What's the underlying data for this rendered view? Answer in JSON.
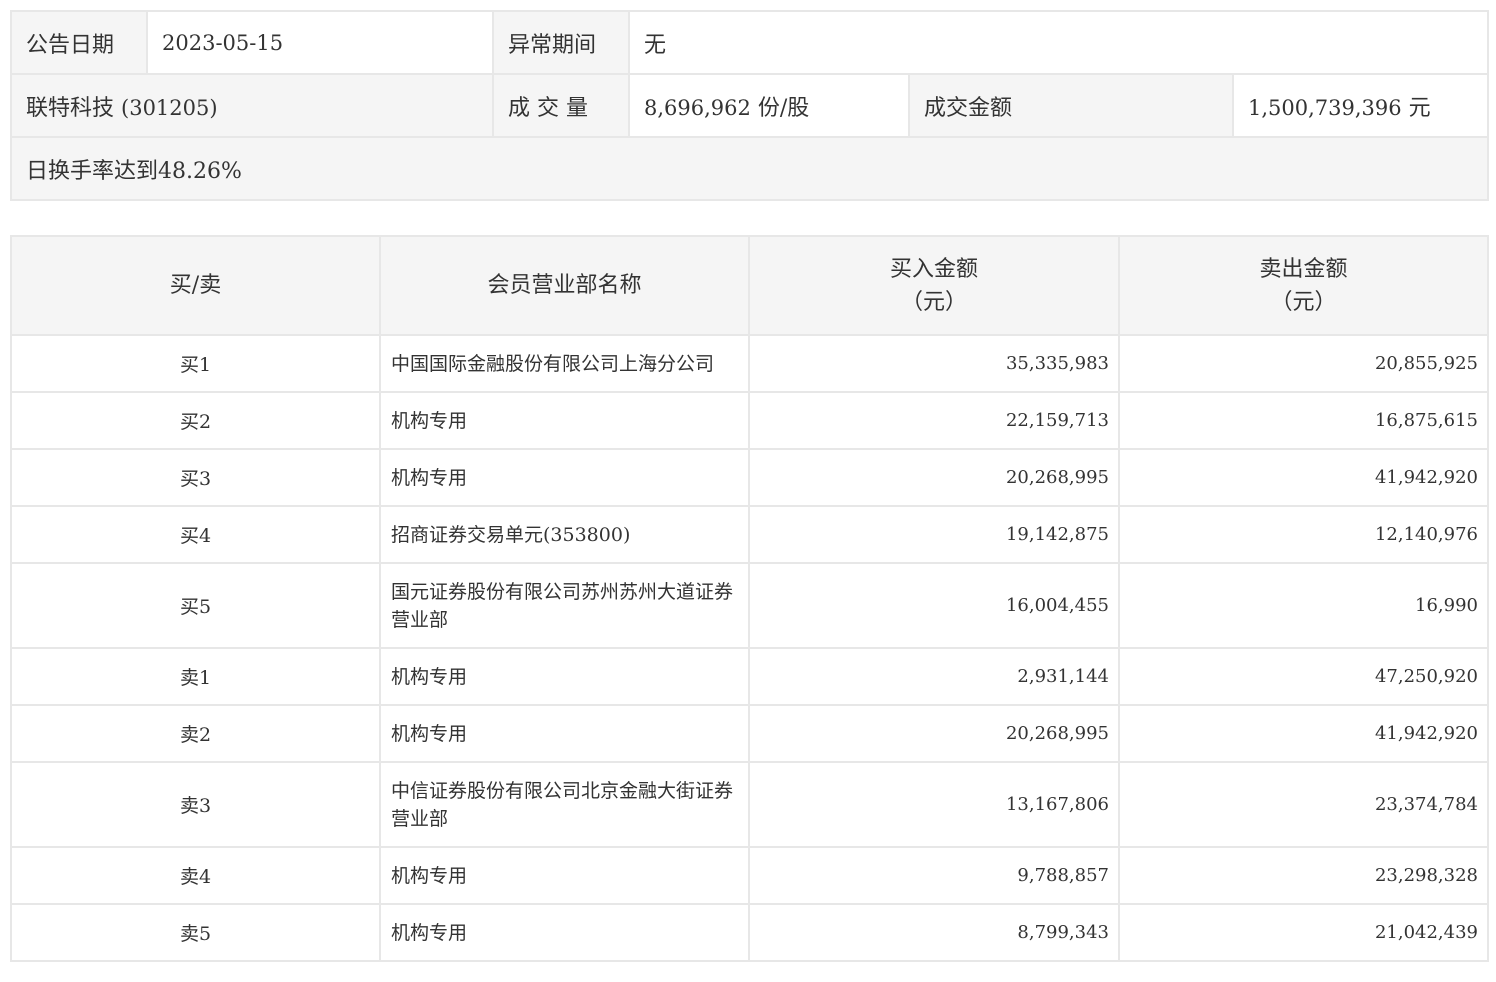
{
  "info": {
    "date_label": "公告日期",
    "date_value": "2023-05-15",
    "period_label": "异常期间",
    "period_value": "无",
    "stock_name": "联特科技",
    "stock_code": "(301205)",
    "volume_label": "成 交 量",
    "volume_value": "8,696,962",
    "volume_unit": " 份/股",
    "turnover_label": "成交金额",
    "turnover_value": "1,500,739,396",
    "turnover_unit": " 元",
    "reason": "日换手率达到48.26%"
  },
  "trade_table": {
    "headers": {
      "side": "买/卖",
      "dept": "会员营业部名称",
      "buy": "买入金额",
      "buy_unit": "（元）",
      "sell": "卖出金额",
      "sell_unit": "（元）"
    },
    "rows": [
      {
        "side": "买1",
        "dept": "中国国际金融股份有限公司上海分公司",
        "buy": "35,335,983",
        "sell": "20,855,925"
      },
      {
        "side": "买2",
        "dept": "机构专用",
        "buy": "22,159,713",
        "sell": "16,875,615"
      },
      {
        "side": "买3",
        "dept": "机构专用",
        "buy": "20,268,995",
        "sell": "41,942,920"
      },
      {
        "side": "买4",
        "dept": "招商证券交易单元(353800)",
        "buy": "19,142,875",
        "sell": "12,140,976"
      },
      {
        "side": "买5",
        "dept": "国元证券股份有限公司苏州苏州大道证券营业部",
        "buy": "16,004,455",
        "sell": "16,990"
      },
      {
        "side": "卖1",
        "dept": "机构专用",
        "buy": "2,931,144",
        "sell": "47,250,920"
      },
      {
        "side": "卖2",
        "dept": "机构专用",
        "buy": "20,268,995",
        "sell": "41,942,920"
      },
      {
        "side": "卖3",
        "dept": "中信证券股份有限公司北京金融大街证券营业部",
        "buy": "13,167,806",
        "sell": "23,374,784"
      },
      {
        "side": "卖4",
        "dept": "机构专用",
        "buy": "9,788,857",
        "sell": "23,298,328"
      },
      {
        "side": "卖5",
        "dept": "机构专用",
        "buy": "8,799,343",
        "sell": "21,042,439"
      }
    ]
  }
}
